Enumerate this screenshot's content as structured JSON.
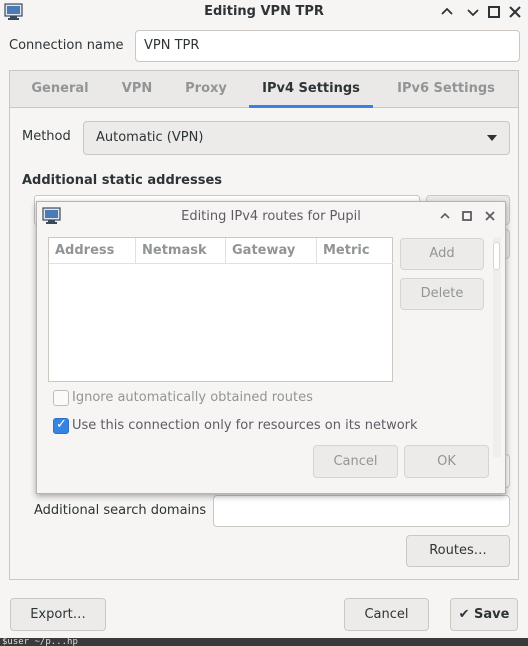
{
  "window": {
    "title": "Editing VPN TPR",
    "icon": "network-monitor-icon",
    "controls": {
      "minimize": "⌃",
      "maximize": "□",
      "close": "✕"
    }
  },
  "connection": {
    "name_label": "Connection name",
    "name_value": "VPN TPR"
  },
  "tabs": [
    {
      "label": "General",
      "active": false
    },
    {
      "label": "VPN",
      "active": false
    },
    {
      "label": "Proxy",
      "active": false
    },
    {
      "label": "IPv4 Settings",
      "active": true
    },
    {
      "label": "IPv6 Settings",
      "active": false
    }
  ],
  "ipv4": {
    "method_label": "Method",
    "method_value": "Automatic (VPN)",
    "additional_static_heading": "Additional static addresses",
    "search_domains_label": "Additional search domains",
    "search_domains_value": "",
    "routes_button": "Routes…"
  },
  "footer": {
    "export": "Export…",
    "cancel": "Cancel",
    "save": "Save"
  },
  "dialog": {
    "title": "Editing IPv4 routes for Pupil",
    "columns": [
      "Address",
      "Netmask",
      "Gateway",
      "Metric"
    ],
    "add": "Add",
    "delete": "Delete",
    "ignore_routes_label": "Ignore automatically obtained routes",
    "ignore_routes_checked": false,
    "only_resources_label": "Use this connection only for resources on its network",
    "only_resources_checked": true,
    "cancel": "Cancel",
    "ok": "OK"
  },
  "colors": {
    "accent": "#3584e4",
    "window_bg": "#f6f5f4"
  },
  "terminal_strip": "$user ~/p...hp"
}
